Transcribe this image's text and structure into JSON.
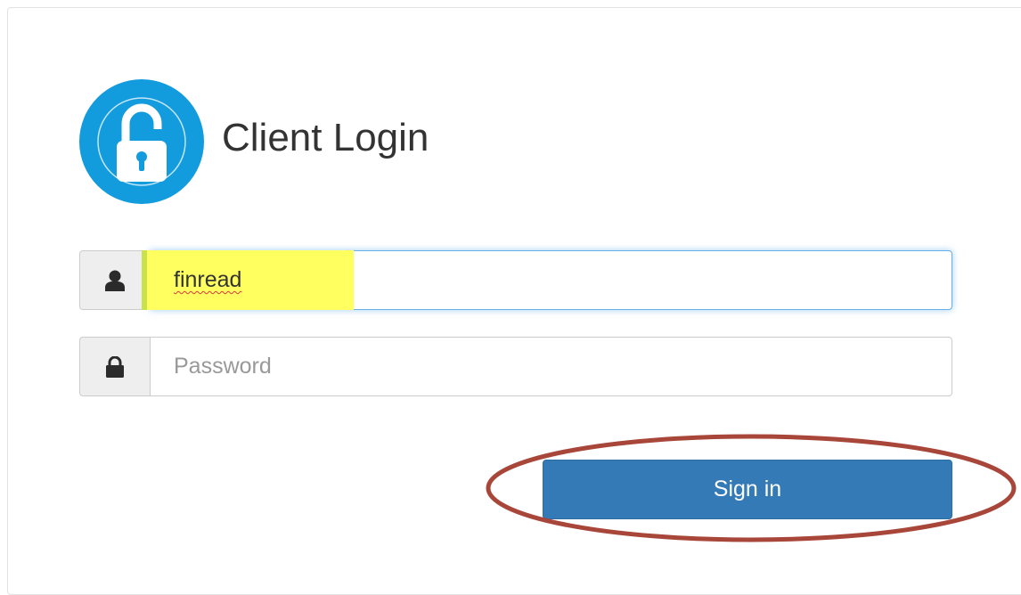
{
  "header": {
    "title": "Client Login",
    "logo_icon": "lock-icon"
  },
  "username": {
    "icon": "user-icon",
    "value": "finread"
  },
  "password": {
    "icon": "lock-icon",
    "placeholder": "Password"
  },
  "sign_in": {
    "label": "Sign in"
  },
  "colors": {
    "brand_blue": "#129bdd",
    "button_blue": "#337ab7",
    "highlight_yellow": "#ffff60",
    "annotation_red": "#a8463a"
  }
}
